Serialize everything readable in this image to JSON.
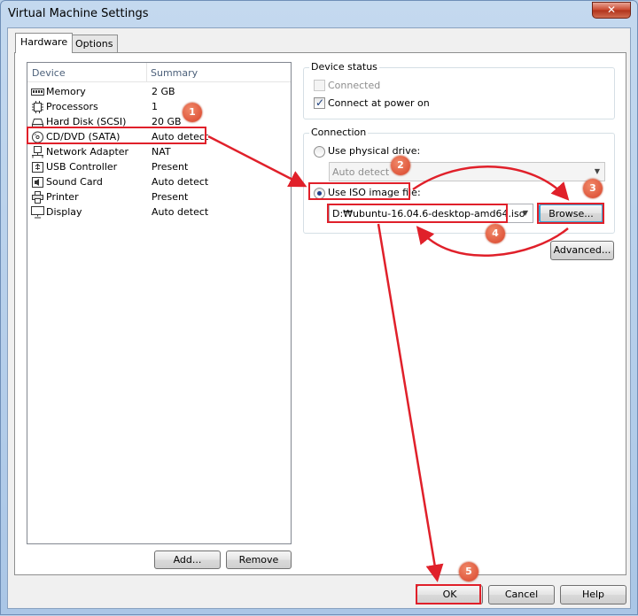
{
  "window": {
    "title": "Virtual Machine Settings",
    "close_label": "✕"
  },
  "tabs": [
    {
      "label": "Hardware",
      "active": true
    },
    {
      "label": "Options",
      "active": false
    }
  ],
  "device_list": {
    "columns": {
      "device": "Device",
      "summary": "Summary"
    },
    "rows": [
      {
        "device": "Memory",
        "summary": "2 GB",
        "icon": "memory-icon"
      },
      {
        "device": "Processors",
        "summary": "1",
        "icon": "processor-icon"
      },
      {
        "device": "Hard Disk (SCSI)",
        "summary": "20 GB",
        "icon": "hard-disk-icon"
      },
      {
        "device": "CD/DVD (SATA)",
        "summary": "Auto detect",
        "icon": "cd-dvd-icon"
      },
      {
        "device": "Network Adapter",
        "summary": "NAT",
        "icon": "network-adapter-icon"
      },
      {
        "device": "USB Controller",
        "summary": "Present",
        "icon": "usb-controller-icon"
      },
      {
        "device": "Sound Card",
        "summary": "Auto detect",
        "icon": "sound-card-icon"
      },
      {
        "device": "Printer",
        "summary": "Present",
        "icon": "printer-icon"
      },
      {
        "device": "Display",
        "summary": "Auto detect",
        "icon": "display-icon"
      }
    ],
    "add_label": "Add...",
    "remove_label": "Remove"
  },
  "device_status": {
    "title": "Device status",
    "connected_label": "Connected",
    "connect_power_label": "Connect at power on"
  },
  "connection": {
    "title": "Connection",
    "physical_label": "Use physical drive:",
    "physical_value": "Auto detect",
    "iso_label": "Use ISO image file:",
    "iso_value": "D:₩ubuntu-16.04.6-desktop-amd64.iso",
    "browse_label": "Browse...",
    "advanced_label": "Advanced..."
  },
  "footer": {
    "ok_label": "OK",
    "cancel_label": "Cancel",
    "help_label": "Help"
  },
  "annotations": {
    "step1": "1",
    "step2": "2",
    "step3": "3",
    "step4": "4",
    "step5": "5",
    "color": "#e0202a"
  }
}
